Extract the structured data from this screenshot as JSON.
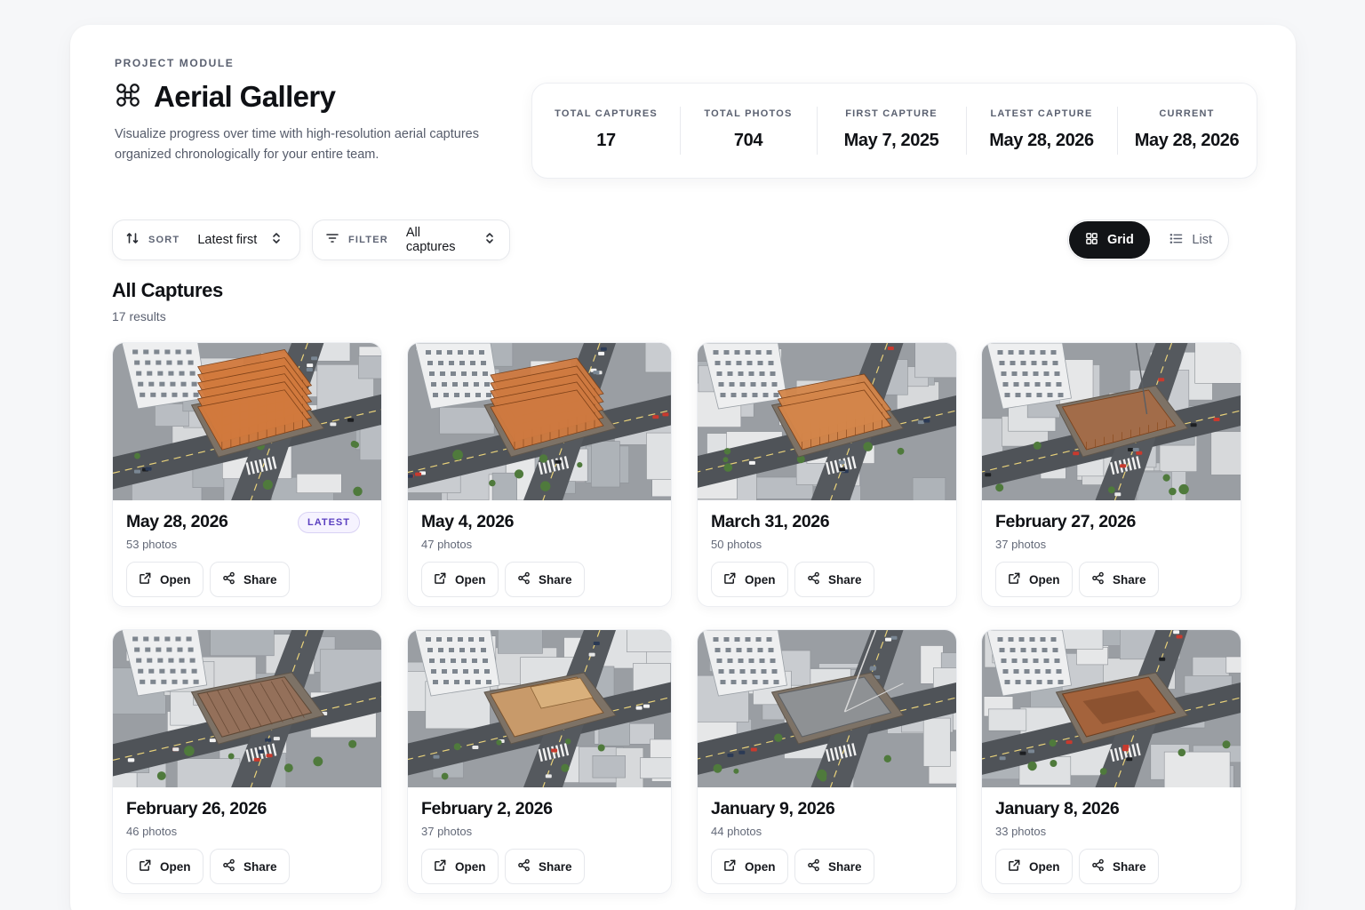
{
  "header": {
    "eyebrow": "PROJECT MODULE",
    "title": "Aerial Gallery",
    "icon": "drone-icon",
    "subtitle": "Visualize progress over time with high-resolution aerial captures organized chronologically for your entire team."
  },
  "stats": [
    {
      "label": "TOTAL CAPTURES",
      "value": "17"
    },
    {
      "label": "TOTAL PHOTOS",
      "value": "704"
    },
    {
      "label": "FIRST CAPTURE",
      "value": "May 7, 2025"
    },
    {
      "label": "LATEST CAPTURE",
      "value": "May 28, 2026"
    },
    {
      "label": "CURRENT",
      "value": "May 28, 2026"
    }
  ],
  "controls": {
    "sort": {
      "label": "SORT",
      "value": "Latest first"
    },
    "filter": {
      "label": "FILTER",
      "value": "All captures"
    },
    "view": {
      "grid": "Grid",
      "list": "List",
      "active": "grid"
    }
  },
  "section": {
    "title": "All Captures",
    "count": "17 results"
  },
  "card_actions": {
    "open": "Open",
    "share": "Share"
  },
  "colors": {
    "accent_dark": "#121417",
    "badge_text": "#5a3fc0",
    "badge_bg": "#f6f3ff"
  },
  "captures": [
    {
      "date": "May 28, 2026",
      "photos": "53 photos",
      "badge": "LATEST",
      "stage": "frame-complete"
    },
    {
      "date": "May 4, 2026",
      "photos": "47 photos",
      "stage": "frame-upper"
    },
    {
      "date": "March 31, 2026",
      "photos": "50 photos",
      "stage": "frame-mid"
    },
    {
      "date": "February 27, 2026",
      "photos": "37 photos",
      "stage": "frame-low"
    },
    {
      "date": "February 26, 2026",
      "photos": "46 photos",
      "stage": "podium"
    },
    {
      "date": "February 2, 2026",
      "photos": "37 photos",
      "stage": "podium-wood"
    },
    {
      "date": "January 9, 2026",
      "photos": "44 photos",
      "stage": "slab"
    },
    {
      "date": "January 8, 2026",
      "photos": "33 photos",
      "stage": "excavation"
    }
  ]
}
